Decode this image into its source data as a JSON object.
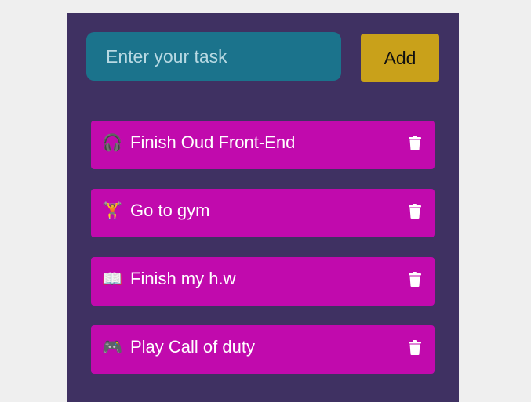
{
  "input": {
    "placeholder": "Enter your task",
    "value": ""
  },
  "add_button": {
    "label": "Add"
  },
  "tasks": [
    {
      "emoji": "🎧",
      "text": "Finish Oud Front-End",
      "delete_icon": "trash-icon"
    },
    {
      "emoji": "🏋",
      "text": "Go to gym",
      "delete_icon": "trash-icon"
    },
    {
      "emoji": "📖",
      "text": "Finish my h.w",
      "delete_icon": "trash-icon"
    },
    {
      "emoji": "🎮",
      "text": "Play Call of duty",
      "delete_icon": "trash-icon"
    }
  ],
  "colors": {
    "page_background": "#efefef",
    "panel": "#3f3162",
    "input": "#1b738c",
    "add_button": "#c9a11a",
    "task_item": "#c10aad",
    "task_text": "#ffffff"
  }
}
